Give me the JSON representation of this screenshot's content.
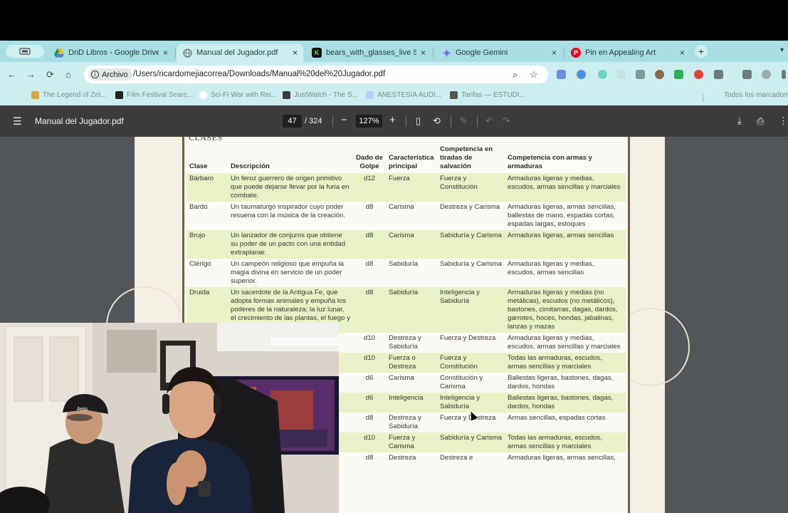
{
  "tabs": {
    "overview_icon": "tab-overview-icon",
    "items": [
      {
        "title": "DnD Libros - Google Drive",
        "close": "×",
        "color": "#1e8e3e"
      },
      {
        "title": "Manual del Jugador.pdf",
        "close": "×",
        "color": "#6b7b7d"
      },
      {
        "title": "bears_with_glasses_live Stre",
        "close": "×",
        "color": "#53fc18"
      },
      {
        "title": "Google Gemini",
        "close": "×",
        "color": "#8e6cef"
      },
      {
        "title": "Pin en Appealing Art",
        "close": "×",
        "color": "#e60023"
      }
    ],
    "new_tab": "+"
  },
  "toolbar": {
    "back": "←",
    "forward": "→",
    "reload": "⟳",
    "home": "⌂",
    "chip_label": "Archivo",
    "url": "/Users/ricardomejiacorrea/Downloads/Manual%20del%20Jugador.pdf",
    "zoom_icon": "⌕",
    "star_icon": "☆"
  },
  "bookmarks": [
    {
      "label": "The Legend of Zel...",
      "color": "#d9a441"
    },
    {
      "label": "Film Festival Searc...",
      "color": "#222222"
    },
    {
      "label": "Sci-Fi War with Rei...",
      "color": "#ffffff"
    },
    {
      "label": "JustWatch - The S...",
      "color": "#3a3a3a"
    },
    {
      "label": "ANESTESIA AUDI...",
      "color": "#c0c8ff"
    },
    {
      "label": "Tarifas — ESTUDI...",
      "color": "#555555"
    },
    {
      "label": "Todos los marcadores",
      "color": "#888888"
    }
  ],
  "viewer": {
    "filename": "Manual del Jugador.pdf",
    "page": "47",
    "total": "/ 324",
    "zoom": "127%",
    "minus": "−",
    "plus": "+"
  },
  "document": {
    "section_title": "Clases",
    "headers": {
      "clase": "Clase",
      "descripcion": "Descripción",
      "dado": "Dado de Golpe",
      "caract": "Característica principal",
      "salv": "Competencia en tiradas de salvación",
      "armas": "Competencia con armas y armaduras"
    },
    "rows": [
      [
        "Bárbaro",
        "Un feroz guerrero de origen primitivo que puede dejarse llevar por la furia en combate.",
        "d12",
        "Fuerza",
        "Fuerza y Constitución",
        "Armaduras ligeras y medias, escudos, armas sencillas y marciales"
      ],
      [
        "Bardo",
        "Un taumaturgo inspirador cuyo poder resuena con la música de la creación.",
        "d8",
        "Carisma",
        "Destreza y Carisma",
        "Armaduras ligeras, armas sencillas, ballestas de mano, espadas cortas, espadas largas, estoques"
      ],
      [
        "Brujo",
        "Un lanzador de conjuros que obtiene su poder de un pacto con una entidad extraplanar.",
        "d8",
        "Carisma",
        "Sabiduría y Carisma",
        "Armaduras ligeras, armas sencillas"
      ],
      [
        "Clérigo",
        "Un campeón religioso que empuña la magia divina en servicio de un poder superior.",
        "d8",
        "Sabiduría",
        "Sabiduría y Carisma",
        "Armaduras ligeras y medias, escudos, armas sencillas"
      ],
      [
        "Druida",
        "Un sacerdote de la Antigua Fe, que adopta formas animales y empuña los poderes de la naturaleza; la luz lunar, el crecimiento de las plantas, el fuego y el relámpago.",
        "d8",
        "Sabiduría",
        "Inteligencia y Sabiduría",
        "Armaduras ligeras y medias (no metálicas), escudos (no metálicos), bastones, cimitarras, dagas, dardos, garrotes, hoces, hondas, jabalinas, lanzas y mazas"
      ],
      [
        "",
        "",
        "d10",
        "Destreza y Sabiduría",
        "Fuerza y Destreza",
        "Armaduras ligeras y medias, escudos, armas sencillas y marciales"
      ],
      [
        "",
        "",
        "d10",
        "Fuerza o Destreza",
        "Fuerza y Constitución",
        "Todas las armaduras, escudos, armas sencillas y marciales"
      ],
      [
        "",
        "",
        "d6",
        "Carisma",
        "Constitución y Carisma",
        "Ballestas ligeras, bastones, dagas, dardos, hondas"
      ],
      [
        "",
        "",
        "d6",
        "Inteligencia",
        "Inteligencia y Sabiduría",
        "Ballestas ligeras, bastones, dagas, dardos, hondas"
      ],
      [
        "",
        "",
        "d8",
        "Destreza y Sabiduría",
        "Fuerza y Destreza",
        "Armas sencillas, espadas cortas"
      ],
      [
        "",
        "",
        "d10",
        "Fuerza y Carisma",
        "Sabiduría y Carisma",
        "Todas las armaduras, escudos, armas sencillas y marciales"
      ],
      [
        "",
        "",
        "d8",
        "Destreza",
        "Destreza e",
        "Armaduras ligeras, armas sencillas,"
      ]
    ]
  },
  "webcam": {
    "hat_logo": "Aero"
  }
}
